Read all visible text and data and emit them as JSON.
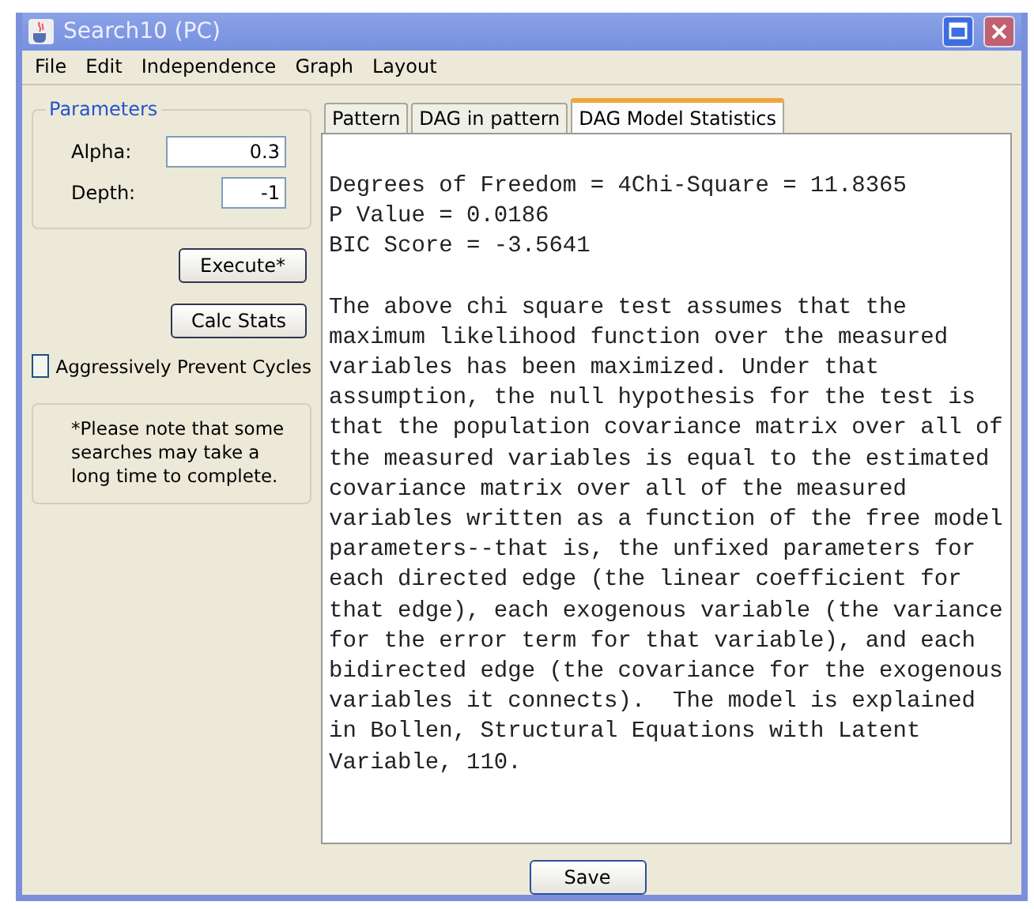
{
  "window": {
    "title": "Search10 (PC)"
  },
  "menu": [
    "File",
    "Edit",
    "Independence",
    "Graph",
    "Layout"
  ],
  "parameters": {
    "title": "Parameters",
    "fields": [
      {
        "label": "Alpha:",
        "value": "0.3"
      },
      {
        "label": "Depth:",
        "value": "-1"
      }
    ]
  },
  "buttons": {
    "execute": "Execute*",
    "calc_stats": "Calc Stats",
    "save": "Save"
  },
  "aggressive_checkbox": {
    "label": "Aggressively Prevent Cycles",
    "checked": false
  },
  "note": "*Please note that some searches may take a long time to complete.",
  "tabs": [
    {
      "label": "Pattern",
      "selected": false
    },
    {
      "label": "DAG in pattern",
      "selected": false
    },
    {
      "label": "DAG Model Statistics",
      "selected": true
    }
  ],
  "stats_lines": [
    "Degrees of Freedom = 4Chi-Square = 11.8365",
    "P Value = 0.0186",
    "BIC Score = -3.5641"
  ],
  "explanation_lines": [
    "The above chi square test assumes that the",
    "maximum likelihood function over the measured",
    "variables has been maximized. Under that",
    "assumption, the null hypothesis for the test is",
    "that the population covariance matrix over all of",
    "the measured variables is equal to the estimated",
    "covariance matrix over all of the measured",
    "variables written as a function of the free model",
    "parameters--that is, the unfixed parameters for",
    "each directed edge (the linear coefficient for",
    "that edge), each exogenous variable (the variance",
    "for the error term for that variable), and each",
    "bidirected edge (the covariance for the exogenous",
    "variables it connects).  The model is explained",
    "in Bollen, Structural Equations with Latent",
    "Variable, 110."
  ]
}
